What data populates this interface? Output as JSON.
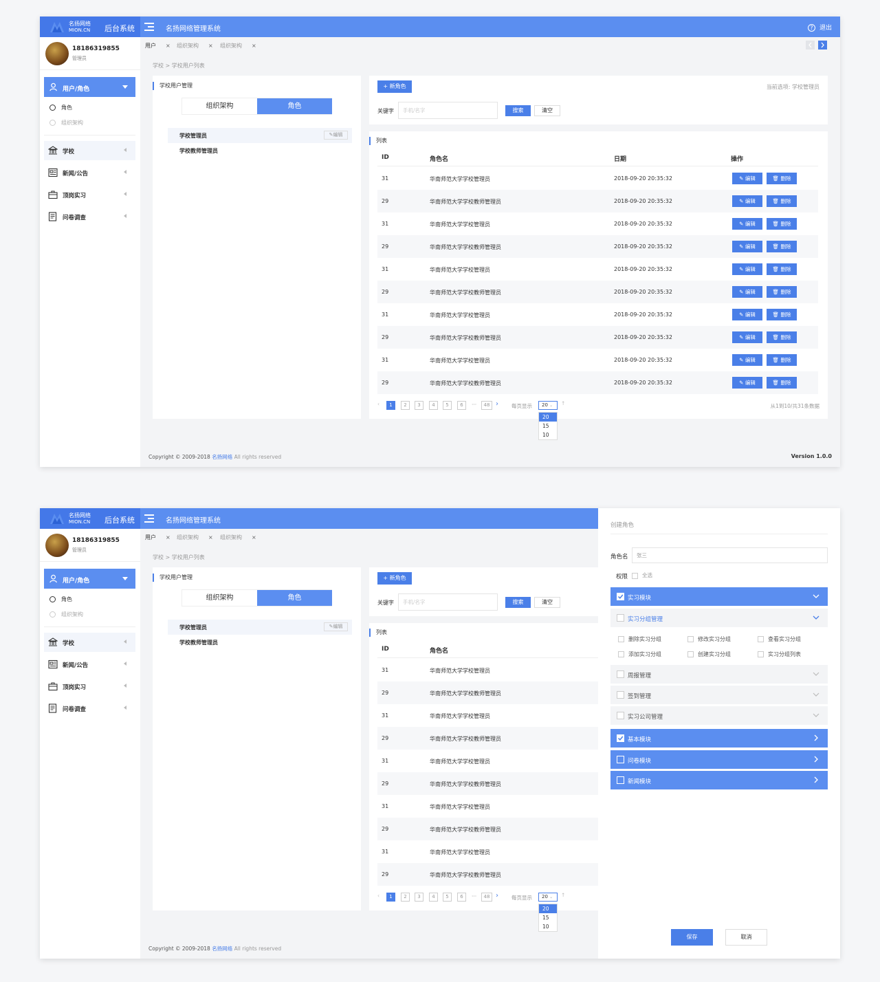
{
  "brand": {
    "name_cn": "名扬网络",
    "name_en": "MION.CN",
    "system": "后台系统"
  },
  "app_title": "名扬网络管理系统",
  "logout": "退出",
  "user": {
    "phone": "18186319855",
    "role": "管理员"
  },
  "nav": {
    "active": "用户/角色",
    "sub": [
      "角色",
      "组织架构"
    ],
    "items": [
      "学校",
      "新闻/公告",
      "顶岗实习",
      "问卷调查"
    ]
  },
  "tabs": [
    "用户",
    "组织架构",
    "组织架构"
  ],
  "breadcrumb": "学校 > 学校用户列表",
  "left_panel": {
    "title": "学校用户管理",
    "seg": [
      "组织架构",
      "角色"
    ],
    "roles": [
      "学校管理员",
      "学校教师管理员"
    ],
    "edit": "编辑"
  },
  "toolbar": {
    "new_role": "+ 新角色",
    "current": "当前选项: 学校管理员",
    "keyword_label": "关键字",
    "keyword_placeholder": "手机/名字",
    "search": "搜索",
    "clear": "清空"
  },
  "table": {
    "title": "列表",
    "headers": [
      "ID",
      "角色名",
      "日期",
      "操作"
    ],
    "rows": [
      {
        "id": "31",
        "name": "华南师范大学学校管理员",
        "date": "2018-09-20 20:35:32"
      },
      {
        "id": "29",
        "name": "华南师范大学学校教师管理员",
        "date": "2018-09-20 20:35:32"
      },
      {
        "id": "31",
        "name": "华南师范大学学校管理员",
        "date": "2018-09-20 20:35:32"
      },
      {
        "id": "29",
        "name": "华南师范大学学校教师管理员",
        "date": "2018-09-20 20:35:32"
      },
      {
        "id": "31",
        "name": "华南师范大学学校管理员",
        "date": "2018-09-20 20:35:32"
      },
      {
        "id": "29",
        "name": "华南师范大学学校教师管理员",
        "date": "2018-09-20 20:35:32"
      },
      {
        "id": "31",
        "name": "华南师范大学学校管理员",
        "date": "2018-09-20 20:35:32"
      },
      {
        "id": "29",
        "name": "华南师范大学学校教师管理员",
        "date": "2018-09-20 20:35:32"
      },
      {
        "id": "31",
        "name": "华南师范大学学校管理员",
        "date": "2018-09-20 20:35:32"
      },
      {
        "id": "29",
        "name": "华南师范大学学校教师管理员",
        "date": "2018-09-20 20:35:32"
      }
    ],
    "edit": "编辑",
    "delete": "删除"
  },
  "pagination": {
    "pages": [
      "1",
      "2",
      "3",
      "4",
      "5",
      "6"
    ],
    "ellipsis": "···",
    "last": "48",
    "per_page_label": "每页显示",
    "per_page": "20",
    "options": [
      "20",
      "15",
      "10"
    ],
    "summary": "从1到10/共31条数据"
  },
  "footer": {
    "copyright": "Copyright © 2009-2018",
    "company": "名扬网络",
    "rights": "All rights reserved",
    "version": "Version 1.0.0"
  },
  "drawer": {
    "title": "创建角色",
    "name_label": "角色名",
    "name_value": "张三",
    "perm_label": "权限",
    "select_all": "全选",
    "modules": [
      "实习模块",
      "实习分组管理",
      "周报管理",
      "签到管理",
      "实习公司管理",
      "基本模块",
      "问卷模块",
      "新闻模块"
    ],
    "perms": [
      "删除实习分组",
      "修改实习分组",
      "查看实习分组",
      "添加实习分组",
      "创建实习分组",
      "实习分组列表"
    ],
    "save": "保存",
    "cancel": "取消"
  },
  "colors": {
    "primary": "#5b8ef0",
    "primary_dark": "#4478e8",
    "button": "#4a7fe8"
  }
}
